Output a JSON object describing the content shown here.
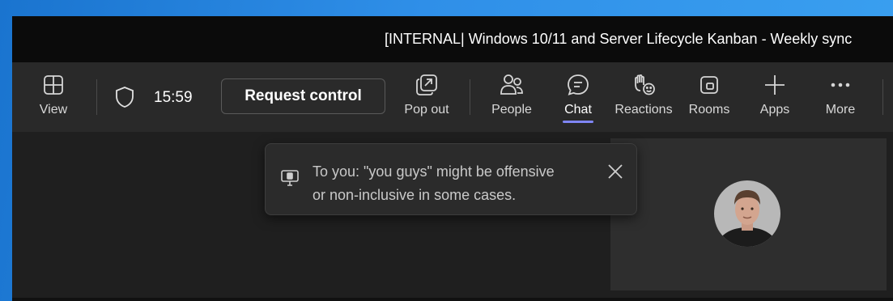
{
  "window": {
    "title": "[INTERNAL| Windows 10/11 and Server Lifecycle Kanban - Weekly sync"
  },
  "toolbar": {
    "view_label": "View",
    "timer": "15:59",
    "request_control_label": "Request control",
    "popout_label": "Pop out",
    "people_label": "People",
    "chat_label": "Chat",
    "reactions_label": "Reactions",
    "rooms_label": "Rooms",
    "apps_label": "Apps",
    "more_label": "More",
    "active_tab": "Chat",
    "accent_color": "#7f85f5"
  },
  "toast": {
    "line1": "To you: \"you guys\" might be offensive",
    "line2": "or non-inclusive in some cases.",
    "icon": "speech-feedback-icon"
  },
  "participant": {
    "avatar_icon": "participant-avatar"
  }
}
